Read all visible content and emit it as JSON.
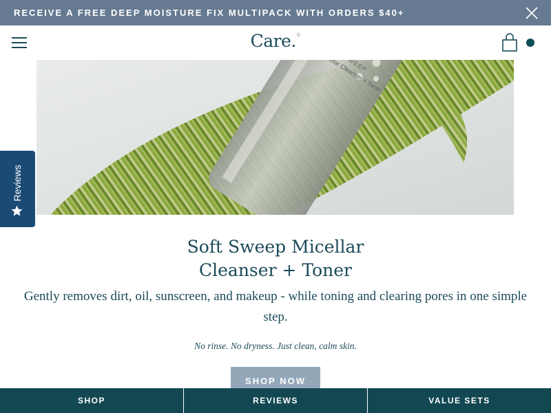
{
  "announcement": {
    "text": "RECEIVE A FREE DEEP MOISTURE FIX MULTIPACK WITH ORDERS $40+",
    "close_icon": "close-icon"
  },
  "header": {
    "menu_icon": "hamburger-menu-icon",
    "logo": "Care.",
    "logo_mark": "®",
    "cart_icon": "shopping-bag-icon"
  },
  "hero": {
    "bottle_label_line1": "SOFT SWEEP",
    "bottle_label_line2": "Micellar Cleanser + Toner"
  },
  "reviews_tab": {
    "label": "Reviews",
    "icon": "star-icon"
  },
  "product": {
    "title_line1": "Soft Sweep Micellar",
    "title_line2": "Cleanser + Toner",
    "description": "Gently removes dirt, oil, sunscreen, and makeup - while toning and clearing pores in one simple step.",
    "tagline": "No rinse. No dryness. Just clean, calm skin.",
    "cta": "SHOP NOW"
  },
  "bottom_nav": {
    "items": [
      {
        "label": "SHOP"
      },
      {
        "label": "REVIEWS"
      },
      {
        "label": "VALUE SETS"
      }
    ]
  },
  "colors": {
    "announcement_bg": "#667a91",
    "brand_text": "#1b4a59",
    "bottom_nav_bg": "#134853",
    "reviews_tab_bg": "#1b4a75",
    "cta_bg": "#93a7b9"
  }
}
